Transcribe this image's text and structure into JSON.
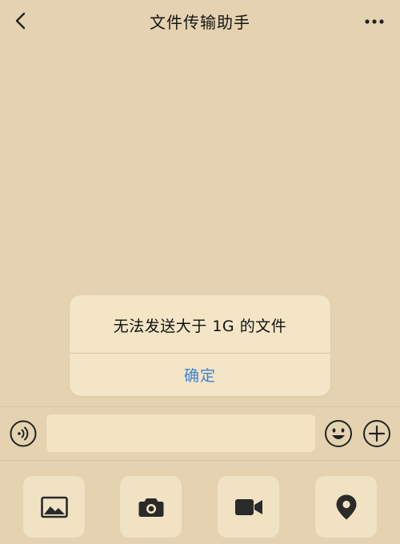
{
  "nav": {
    "title": "文件传输助手",
    "back_icon": "chevron-left-icon",
    "more_icon": "more-dots-icon"
  },
  "alert": {
    "message": "无法发送大于 1G 的文件",
    "confirm_label": "确定"
  },
  "input_bar": {
    "voice_icon": "voice-icon",
    "input_value": "",
    "emoji_icon": "emoji-icon",
    "add_icon": "plus-circle-icon"
  },
  "toolbar": {
    "items": [
      {
        "icon": "image-icon"
      },
      {
        "icon": "camera-icon"
      },
      {
        "icon": "video-icon"
      },
      {
        "icon": "location-icon"
      }
    ]
  },
  "colors": {
    "background": "#e4d2b0",
    "alert_background": "#f3e5c6",
    "accent": "#3b82d6",
    "icon": "#2a2a2a"
  }
}
